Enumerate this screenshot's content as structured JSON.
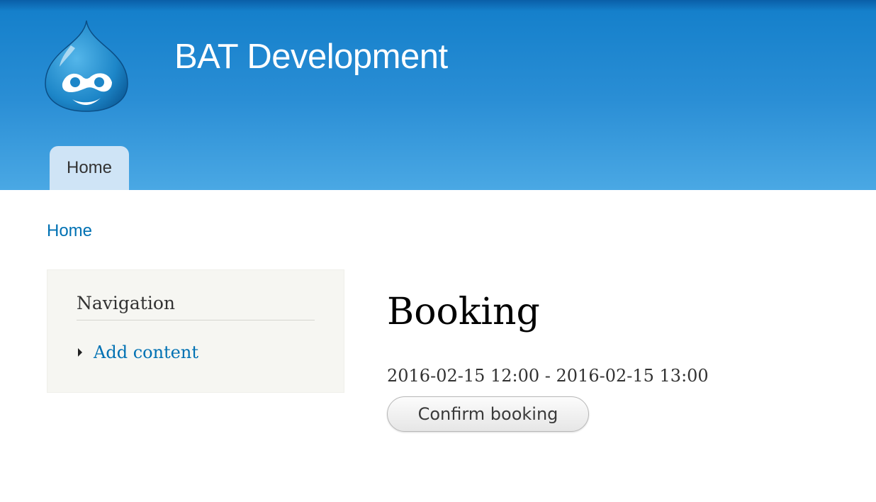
{
  "header": {
    "site_name": "BAT Development",
    "logo_icon": "drupal-drop-logo",
    "colors": {
      "gradient_top": "#0a5fa8",
      "gradient_bottom": "#4aa8e4",
      "tab_background": "#cfe4f6"
    },
    "tabs": [
      {
        "label": "Home",
        "active": true
      }
    ]
  },
  "breadcrumb": {
    "items": [
      "Home"
    ]
  },
  "sidebar": {
    "title": "Navigation",
    "items": [
      {
        "label": "Add content",
        "icon": "triangle-right-icon"
      }
    ]
  },
  "main": {
    "title": "Booking",
    "dates": "2016-02-15 12:00 - 2016-02-15 13:00",
    "confirm_label": "Confirm booking"
  },
  "colors": {
    "link": "#0071b3",
    "sidebar_background": "#f6f6f2"
  }
}
